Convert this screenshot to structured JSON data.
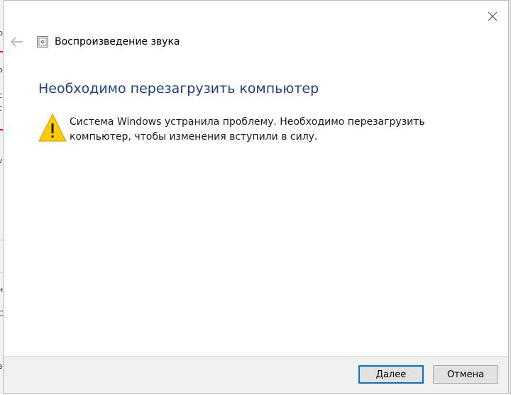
{
  "window": {
    "title": "Воспроизведение звука",
    "close_icon": "close-icon",
    "back_icon": "back-arrow-icon"
  },
  "content": {
    "heading": "Необходимо перезагрузить компьютер",
    "message": "Система Windows устранила проблему. Необходимо перезагрузить компьютер, чтобы изменения вступили в силу.",
    "warning_icon": "warning-icon"
  },
  "footer": {
    "next_label": "Далее",
    "cancel_label": "Отмена"
  },
  "background_window": {
    "fragments": [
      "р",
      "о",
      "с",
      "v",
      "н",
      "С",
      "в"
    ]
  },
  "colors": {
    "heading": "#1e3f8f",
    "accent": "#0078d7",
    "warning": "#ffcc00"
  }
}
